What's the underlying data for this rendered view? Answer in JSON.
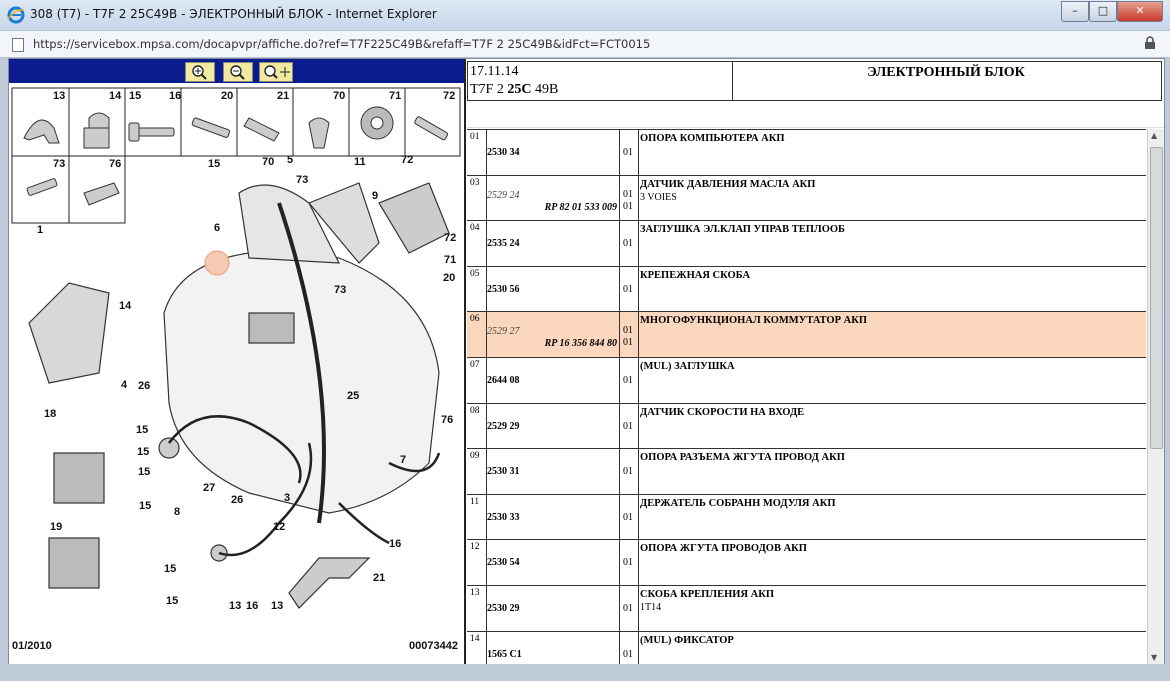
{
  "window": {
    "title": "308 (T7) - T7F 2 25C49B - ЭЛЕКТРОННЫЙ БЛОК - Internet Explorer",
    "minimize": "–",
    "maximize": "□",
    "close": "✕"
  },
  "address": {
    "url": "https://servicebox.mpsa.com/docapvpr/affiche.do?ref=T7F225C49B&refaff=T7F 2 25C49B&idFct=FCT0015"
  },
  "toolbar": {
    "buttons": [
      "zoom-in-icon",
      "zoom-out-icon",
      "zoom-fit-icon"
    ]
  },
  "diagram": {
    "small_parts": [
      "13",
      "14",
      "15",
      "16",
      "20",
      "21",
      "70",
      "71",
      "72",
      "73",
      "76"
    ],
    "labels": [
      "15",
      "70",
      "5",
      "11",
      "72",
      "73",
      "9",
      "6",
      "72",
      "71",
      "20",
      "1",
      "73",
      "14",
      "4",
      "26",
      "25",
      "76",
      "15",
      "18",
      "15",
      "15",
      "7",
      "27",
      "26",
      "8",
      "3",
      "15",
      "12",
      "16",
      "19",
      "15",
      "21",
      "15",
      "13",
      "16",
      "13"
    ],
    "footer_left": "01/2010",
    "footer_right": "00073442"
  },
  "header": {
    "date": "17.11.14",
    "ref_prefix": "T7F 2 ",
    "ref_bold": "25C",
    "ref_suffix": " 49B",
    "title": "ЭЛЕКТРОННЫЙ БЛОК"
  },
  "parts": [
    {
      "num": "01",
      "code": "2530 34",
      "rp": "",
      "qty1": "01",
      "qty2": "",
      "desc": "ОПОРА КОМПЬЮТЕРА АКП",
      "desc2": "",
      "italic": false,
      "highlight": false
    },
    {
      "num": "03",
      "code": "2529 24",
      "rp": "RP 82 01 533 009",
      "qty1": "01",
      "qty2": "01",
      "desc": "ДАТЧИК ДАВЛЕНИЯ МАСЛА АКП",
      "desc2": "3 VOIES",
      "italic": true,
      "highlight": false
    },
    {
      "num": "04",
      "code": "2535 24",
      "rp": "",
      "qty1": "01",
      "qty2": "",
      "desc": "ЗАГЛУШКА ЭЛ.КЛАП УПРАВ ТЕПЛООБ",
      "desc2": "",
      "italic": false,
      "highlight": false
    },
    {
      "num": "05",
      "code": "2530 56",
      "rp": "",
      "qty1": "01",
      "qty2": "",
      "desc": "КРЕПЕЖНАЯ СКОБА",
      "desc2": "",
      "italic": false,
      "highlight": false
    },
    {
      "num": "06",
      "code": "2529 27",
      "rp": "RP 16 356 844 80",
      "qty1": "01",
      "qty2": "01",
      "desc": "МНОГОФУНКЦИОНАЛ КОММУТАТОР АКП",
      "desc2": "",
      "italic": true,
      "highlight": true
    },
    {
      "num": "07",
      "code": "2644 08",
      "rp": "",
      "qty1": "01",
      "qty2": "",
      "desc": "(MUL) ЗАГЛУШКА",
      "desc2": "",
      "italic": false,
      "highlight": false
    },
    {
      "num": "08",
      "code": "2529 29",
      "rp": "",
      "qty1": "01",
      "qty2": "",
      "desc": "ДАТЧИК СКОРОСТИ НА ВХОДЕ",
      "desc2": "",
      "italic": false,
      "highlight": false
    },
    {
      "num": "09",
      "code": "2530 31",
      "rp": "",
      "qty1": "01",
      "qty2": "",
      "desc": "ОПОРА РАЗЪЕМА ЖГУТА ПРОВОД АКП",
      "desc2": "",
      "italic": false,
      "highlight": false
    },
    {
      "num": "11",
      "code": "2530 33",
      "rp": "",
      "qty1": "01",
      "qty2": "",
      "desc": "ДЕРЖАТЕЛЬ СОБРАНН МОДУЛЯ АКП",
      "desc2": "",
      "italic": false,
      "highlight": false
    },
    {
      "num": "12",
      "code": "2530 54",
      "rp": "",
      "qty1": "01",
      "qty2": "",
      "desc": "ОПОРА ЖГУТА ПРОВОДОВ АКП",
      "desc2": "",
      "italic": false,
      "highlight": false
    },
    {
      "num": "13",
      "code": "2530 29",
      "rp": "",
      "qty1": "01",
      "qty2": "",
      "desc": "СКОБА КРЕПЛЕНИЯ АКП",
      "desc2": "1T14",
      "italic": false,
      "highlight": false
    },
    {
      "num": "14",
      "code": "1565 C1",
      "rp": "",
      "qty1": "01",
      "qty2": "",
      "desc": "(MUL) ФИКСАТОР",
      "desc2": "",
      "italic": false,
      "highlight": false
    }
  ]
}
